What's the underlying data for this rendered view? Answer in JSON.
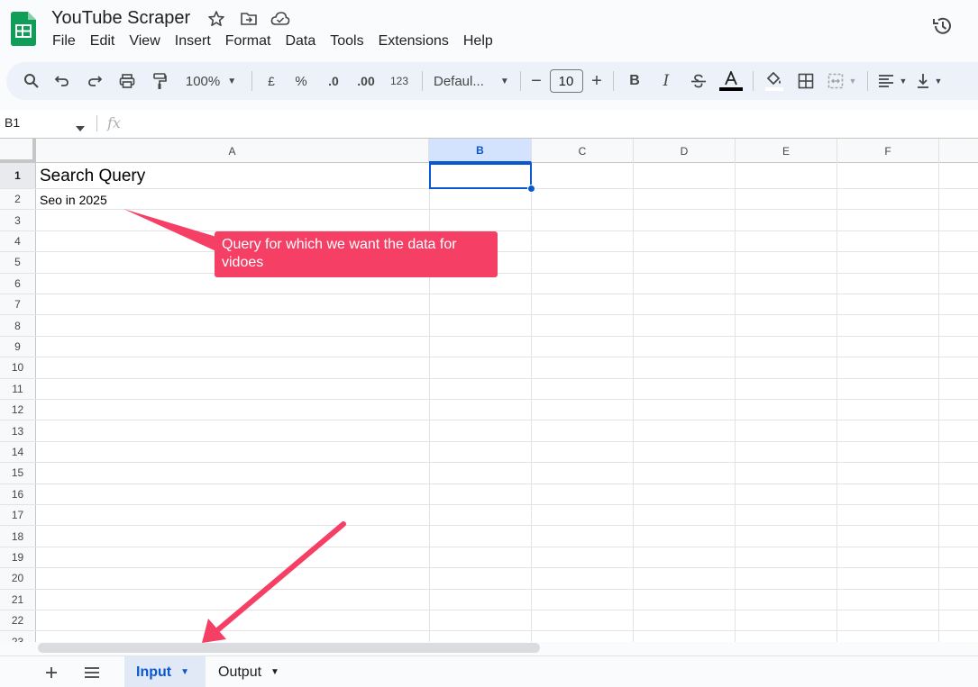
{
  "app": {
    "document_title": "YouTube Scraper",
    "menu": [
      "File",
      "Edit",
      "View",
      "Insert",
      "Format",
      "Data",
      "Tools",
      "Extensions",
      "Help"
    ]
  },
  "toolbar": {
    "zoom": "100%",
    "currency": "£",
    "percent": "%",
    "decrease_decimal": ".0",
    "increase_decimal": ".00",
    "number_format": "123",
    "font": "Defaul...",
    "font_size": "10",
    "bold": "B",
    "italic": "I"
  },
  "formula_bar": {
    "cell_ref": "B1",
    "fx": "fx",
    "value": ""
  },
  "grid": {
    "columns": [
      "A",
      "B",
      "C",
      "D",
      "E",
      "F"
    ],
    "selected_column": "B",
    "rows": [
      "1",
      "2",
      "3",
      "4",
      "5",
      "6",
      "7",
      "8",
      "9",
      "10",
      "11",
      "12",
      "13",
      "14",
      "15",
      "16",
      "17",
      "18",
      "19",
      "20",
      "21",
      "22",
      "23"
    ],
    "cells": {
      "A1": "Search Query",
      "A2": "Seo in 2025"
    }
  },
  "annotation": {
    "callout_text": "Query for which we want the data for vidoes",
    "color": "#f63f64"
  },
  "sheets": {
    "tabs": [
      {
        "label": "Input",
        "active": true
      },
      {
        "label": "Output",
        "active": false
      }
    ]
  },
  "colors": {
    "accent": "#0b57d0",
    "logo_green": "#0f9d58"
  }
}
